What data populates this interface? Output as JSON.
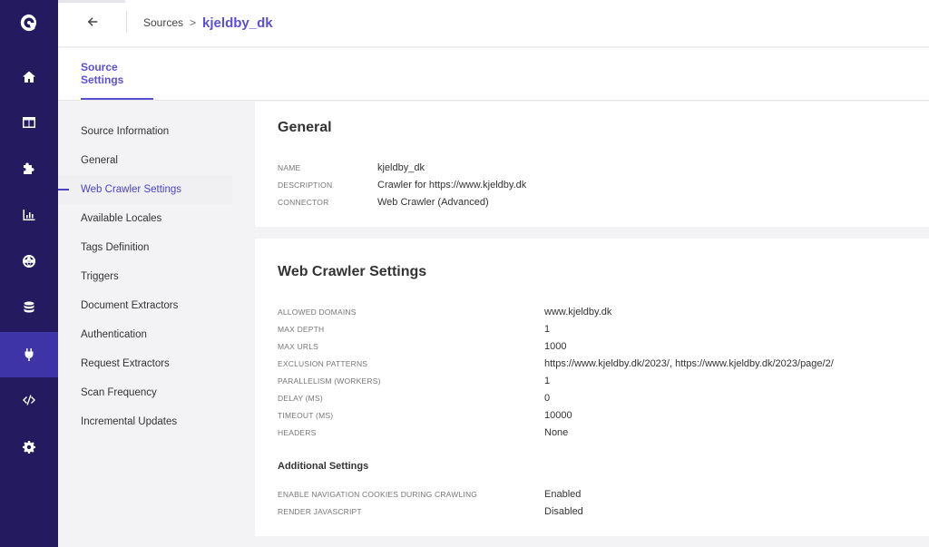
{
  "colors": {
    "rail_bg": "#231a5f",
    "rail_active": "#3e34a8",
    "accent": "#5b4fd6"
  },
  "rail": {
    "items": [
      {
        "icon": "logo-icon"
      },
      {
        "icon": "home-icon"
      },
      {
        "icon": "layout-icon"
      },
      {
        "icon": "puzzle-icon"
      },
      {
        "icon": "analytics-icon"
      },
      {
        "icon": "globe-icon"
      },
      {
        "icon": "database-icon"
      },
      {
        "icon": "plug-icon",
        "active": true
      },
      {
        "icon": "code-icon"
      },
      {
        "icon": "gear-icon"
      }
    ]
  },
  "breadcrumb": {
    "parent": "Sources",
    "separator": ">",
    "current": "kjeldby_dk"
  },
  "tabs": [
    {
      "label": "Source Settings",
      "active": true
    }
  ],
  "section_nav": {
    "items": [
      "Source Information",
      "General",
      "Web Crawler Settings",
      "Available Locales",
      "Tags Definition",
      "Triggers",
      "Document Extractors",
      "Authentication",
      "Request Extractors",
      "Scan Frequency",
      "Incremental Updates"
    ],
    "active_index": 2
  },
  "general": {
    "title": "General",
    "rows": [
      {
        "label": "NAME",
        "value": "kjeldby_dk"
      },
      {
        "label": "DESCRIPTION",
        "value": "Crawler for https://www.kjeldby.dk"
      },
      {
        "label": "CONNECTOR",
        "value": "Web Crawler (Advanced)"
      }
    ]
  },
  "web_crawler": {
    "title": "Web Crawler Settings",
    "rows": [
      {
        "label": "ALLOWED DOMAINS",
        "value": "www.kjeldby.dk"
      },
      {
        "label": "MAX DEPTH",
        "value": "1"
      },
      {
        "label": "MAX URLS",
        "value": "1000"
      },
      {
        "label": "EXCLUSION PATTERNS",
        "value": "https://www.kjeldby.dk/2023/, https://www.kjeldby.dk/2023/page/2/"
      },
      {
        "label": "PARALLELISM (WORKERS)",
        "value": "1"
      },
      {
        "label": "DELAY (MS)",
        "value": "0"
      },
      {
        "label": "TIMEOUT (MS)",
        "value": "10000"
      },
      {
        "label": "HEADERS",
        "value": "None"
      }
    ],
    "additional_title": "Additional Settings",
    "additional_rows": [
      {
        "label": "ENABLE NAVIGATION COOKIES DURING CRAWLING",
        "value": "Enabled"
      },
      {
        "label": "RENDER JAVASCRIPT",
        "value": "Disabled"
      }
    ]
  }
}
